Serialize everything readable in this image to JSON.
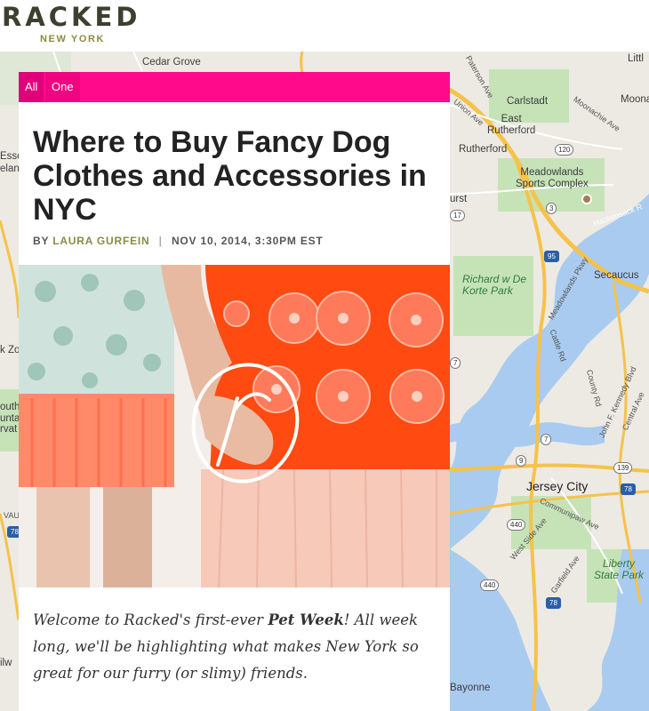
{
  "header": {
    "logo": "RACKED",
    "city": "NEW YORK"
  },
  "map": {
    "labels": {
      "cedar_grove": "Cedar Grove",
      "carlstadt": "Carlstadt",
      "east_rutherford": "East\nRutherford",
      "rutherford": "Rutherford",
      "meadowlands": "Meadowlands\nSports Complex",
      "secaucus": "Secaucus",
      "richard_korte_park": "Richard w De\nKorte Park",
      "jersey_city": "Jersey City",
      "liberty_state_park": "Liberty\nState Park",
      "bayonne": "Bayonne",
      "little": "Littl",
      "moona": "Moona",
      "urst": "urst",
      "esse": "Esse",
      "elan": "elan",
      "kzo": "k Zo",
      "outh": "outh\nunta\nrvat",
      "vau": "VAU",
      "ilw": "ilw",
      "paterson_ave": "Paterson Ave",
      "union_ave": "Union Ave",
      "moonachie_ave": "Moonachie Ave",
      "hackensack_r": "Hackensack R",
      "meadowlands_pkwy": "Meadowlands Pkwy",
      "cattle_rd": "Cattle Rd",
      "county_rd": "County Rd",
      "jfk_blvd": "John F. Kennedy Blvd",
      "central_ave": "Central Ave",
      "communipaw_ave": "Communipaw Ave",
      "west_side_ave": "West Side Ave",
      "garfield_ave": "Garfield Ave"
    },
    "shields": {
      "s120": "120",
      "s3": "3",
      "s17": "17",
      "s95": "95",
      "s7a": "7",
      "s7b": "7",
      "s9": "9",
      "s139": "139",
      "s78a": "78",
      "s78b": "78",
      "s78c": "78",
      "s440a": "440",
      "s440b": "440"
    }
  },
  "article": {
    "tabs": [
      "All",
      "One"
    ],
    "title": "Where to Buy Fancy Dog Clothes and Accessories in NYC",
    "byline_prefix": "BY",
    "author": "LAURA GURFEIN",
    "separator": "|",
    "date": "NOV 10, 2014, 3:30PM EST",
    "intro_before": "Welcome to Racked's first-ever ",
    "intro_bold": "Pet Week",
    "intro_after": "! All week long, we'll be highlighting what makes New York so great for our furry (or slimy) friends."
  },
  "colors": {
    "accent_pink": "#ff0a8a",
    "logo_olive": "#8b8a45",
    "map_water": "#a9cbf0",
    "map_park": "#c6e3b8",
    "highway": "#f6c24a"
  },
  "icons": {
    "hero_logo": "racked-r-logo-icon",
    "map_pin": "place-pin-icon"
  }
}
